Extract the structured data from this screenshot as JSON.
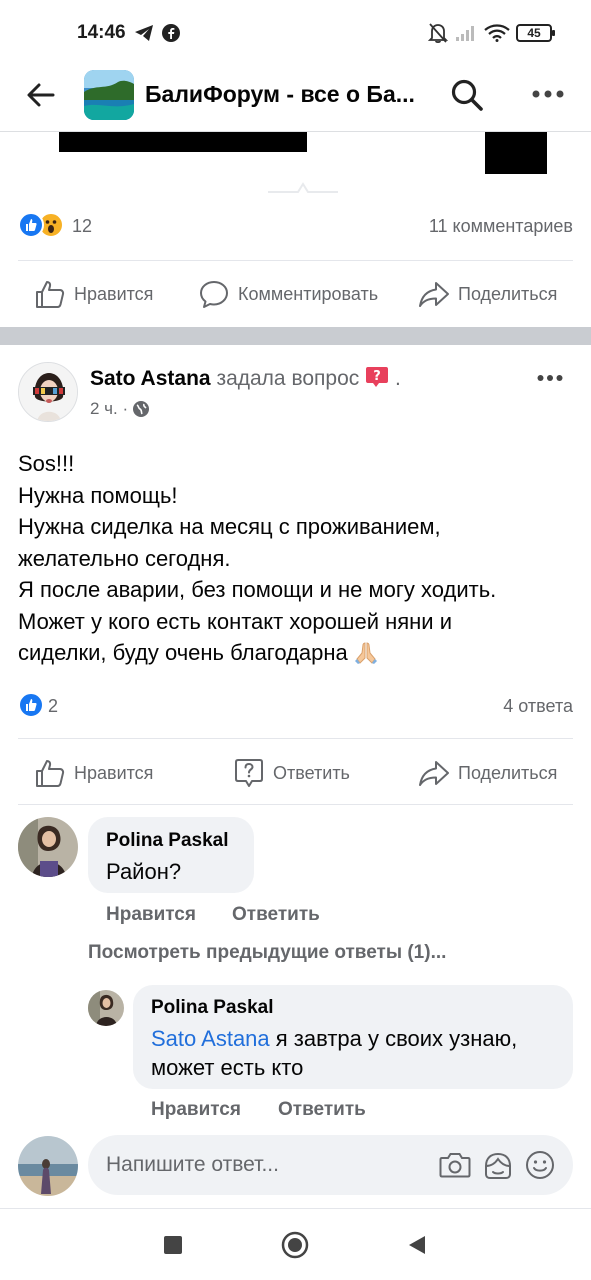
{
  "status_bar": {
    "time": "14:46",
    "battery": "45"
  },
  "header": {
    "title": "БалиФорум - все о Ба..."
  },
  "post1": {
    "reactions_count": "12",
    "comments_count": "11 комментариев",
    "actions": {
      "like": "Нравится",
      "comment": "Комментировать",
      "share": "Поделиться"
    }
  },
  "post2": {
    "author": "Sato Astana",
    "asked": "задала вопрос",
    "dot": ".",
    "time": "2 ч. ·",
    "body_lines": [
      "Sos!!!",
      "Нужна помощь!",
      "Нужна сиделка на месяц с проживанием,",
      "желательно сегодня.",
      "Я после аварии, без помощи и не могу ходить.",
      "Может у кого есть контакт хорошей няни и",
      "сиделки, буду очень благодарна"
    ],
    "reactions_count": "2",
    "answers_count": "4 ответа",
    "actions": {
      "like": "Нравится",
      "reply": "Ответить",
      "share": "Поделиться"
    }
  },
  "comments": [
    {
      "author": "Polina Paskal",
      "text": "Район?",
      "like": "Нравится",
      "reply": "Ответить"
    }
  ],
  "view_previous": "Посмотреть предыдущие ответы (1)...",
  "reply": {
    "author": "Polina Paskal",
    "mention": "Sato Astana",
    "text_rest": " я завтра у своих узнаю,",
    "text_line2": "может есть кто",
    "like": "Нравится",
    "reply": "Ответить"
  },
  "composer": {
    "placeholder": "Напишите ответ..."
  },
  "colors": {
    "accent": "#216fdb",
    "like_blue": "#1877f2",
    "muted": "#65676b",
    "bubble": "#f0f2f5"
  }
}
